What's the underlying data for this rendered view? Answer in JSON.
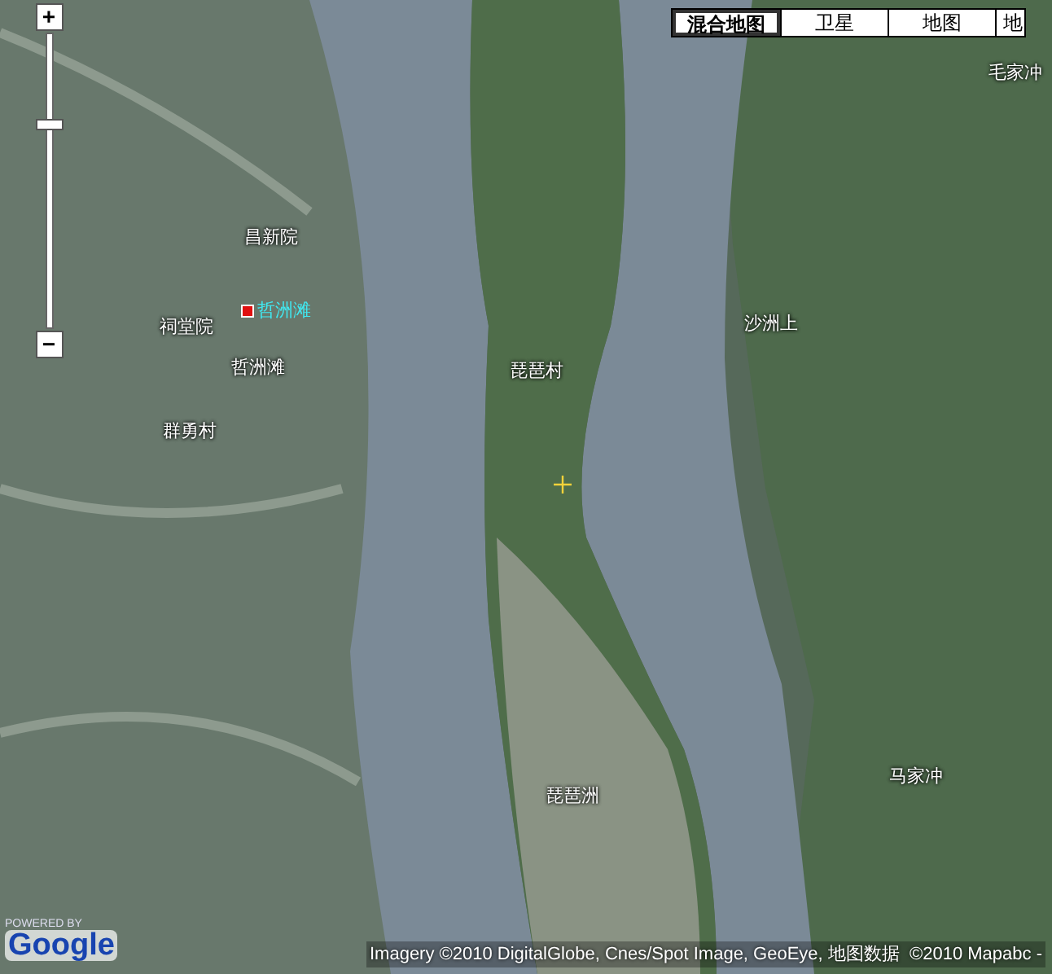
{
  "map_types": [
    {
      "label": "混合地图",
      "selected": true
    },
    {
      "label": "卫星",
      "selected": false
    },
    {
      "label": "地图",
      "selected": false
    },
    {
      "label": "地",
      "selected": false
    }
  ],
  "zoom": {
    "plus": "+",
    "minus": "−",
    "level": 0.7
  },
  "places": [
    {
      "label": "毛家冲",
      "kind": "place"
    },
    {
      "label": "昌新院",
      "kind": "place"
    },
    {
      "label": "哲洲滩",
      "kind": "marker"
    },
    {
      "label": "祠堂院",
      "kind": "place"
    },
    {
      "label": "沙洲上",
      "kind": "place"
    },
    {
      "label": "哲洲滩",
      "kind": "place"
    },
    {
      "label": "琵琶村",
      "kind": "place"
    },
    {
      "label": "群勇村",
      "kind": "place"
    },
    {
      "label": "马家冲",
      "kind": "place"
    },
    {
      "label": "琵琶洲",
      "kind": "place"
    }
  ],
  "logo": {
    "powered_by": "POWERED BY",
    "name": "Google"
  },
  "attribution": "Imagery ©2010 DigitalGlobe, Cnes/Spot Image, GeoEye, 地图数据  ©2010 Mapabc -"
}
